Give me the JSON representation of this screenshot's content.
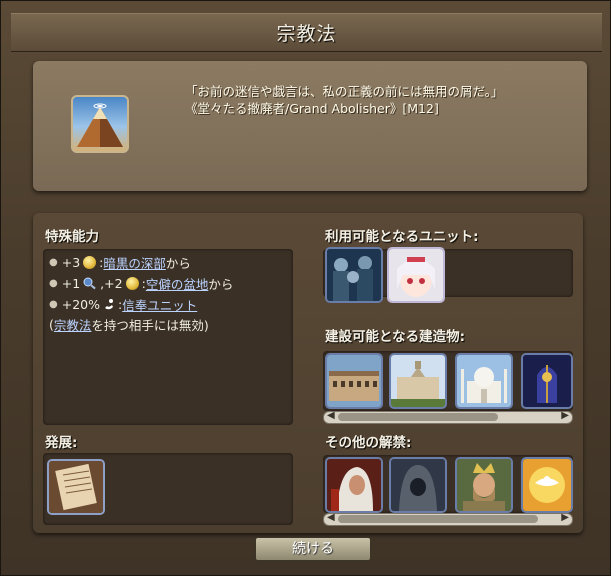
{
  "window": {
    "title": "宗教法"
  },
  "quote": {
    "line1": "「お前の迷信や戯言は、私の正義の前には無用の屑だ。」",
    "line2": "《堂々たる撤廃者/Grand Abolisher》[M12]"
  },
  "tech_icon": "pyramid-icon",
  "special_abilities": {
    "header": "特殊能力",
    "line1": {
      "value": "+3",
      "sep": " : ",
      "link": "暗黒の深部",
      "suffix": "から"
    },
    "line2": {
      "value1": "+1",
      "sep1": ", ",
      "value2": "+2",
      "sep2": " : ",
      "link": "空僻の盆地",
      "suffix": "から"
    },
    "line3": {
      "value": "+20%",
      "sep": " : ",
      "link": "信奉ユニット"
    },
    "line4": {
      "prefix": "(",
      "link": "宗教法",
      "suffix": "を持つ相手には無効)"
    }
  },
  "available_units": {
    "header": "利用可能となるユニット:",
    "items": [
      "zombie-horde-unit",
      "white-haired-girl-unit"
    ]
  },
  "buildable_buildings": {
    "header": "建設可能となる建造物:",
    "items": [
      "palace-building",
      "mansion-building",
      "taj-mahal-building",
      "cathedral-building"
    ]
  },
  "other_unlocks": {
    "header": "その他の解禁:",
    "items": [
      "hooded-monk-unlock",
      "hooded-figure-unlock",
      "crowned-king-unlock",
      "dove-sun-unlock"
    ]
  },
  "development": {
    "header": "発展:",
    "items": [
      "scroll-tech"
    ]
  },
  "buttons": {
    "continue": "続ける"
  },
  "colors": {
    "link": "#bcd3ff",
    "frame": "#5a4a36",
    "panel": "#8c7a62"
  }
}
